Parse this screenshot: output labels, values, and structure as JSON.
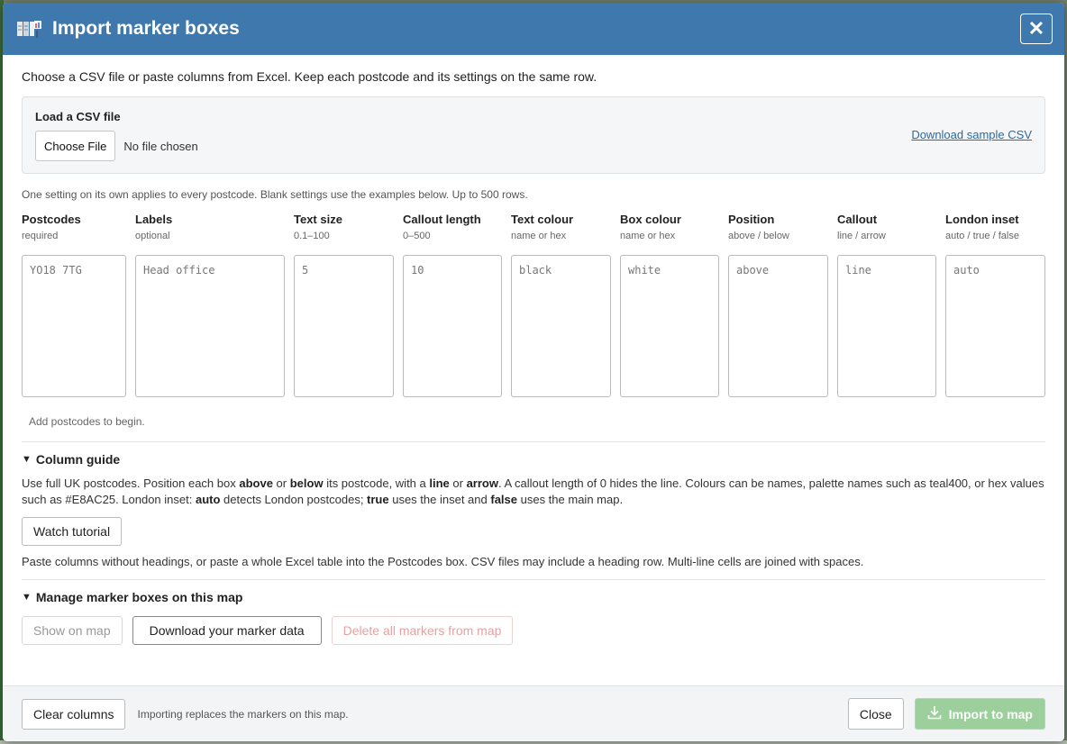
{
  "dialog": {
    "title": "Import marker boxes",
    "close_symbol": "✕",
    "intro": "Choose a CSV file or paste columns from Excel. Keep each postcode and its settings on the same row."
  },
  "csv": {
    "label": "Load a CSV file",
    "choose_button": "Choose File",
    "file_status": "No file chosen",
    "sample_link": "Download sample CSV"
  },
  "note": "One setting on its own applies to every postcode. Blank settings use the examples below. Up to 500 rows.",
  "columns": [
    {
      "header": "Postcodes",
      "sub": "required",
      "placeholder": "YO18 7TG"
    },
    {
      "header": "Labels",
      "sub": "optional",
      "placeholder": "Head office"
    },
    {
      "header": "Text size",
      "sub": "0.1–100",
      "placeholder": "5"
    },
    {
      "header": "Callout length",
      "sub": "0–500",
      "placeholder": "10"
    },
    {
      "header": "Text colour",
      "sub": "name or hex",
      "placeholder": "black"
    },
    {
      "header": "Box colour",
      "sub": "name or hex",
      "placeholder": "white"
    },
    {
      "header": "Position",
      "sub": "above / below",
      "placeholder": "above"
    },
    {
      "header": "Callout",
      "sub": "line / arrow",
      "placeholder": "line"
    },
    {
      "header": "London inset",
      "sub": "auto / true / false",
      "placeholder": "auto"
    }
  ],
  "status": "Add postcodes to begin.",
  "guide": {
    "title": "Column guide",
    "t1": "Use full UK postcodes. Position each box ",
    "b1": "above",
    "t2": " or ",
    "b2": "below",
    "t3": " its postcode, with a ",
    "b3": "line",
    "t4": " or ",
    "b4": "arrow",
    "t5": ". A callout length of 0 hides the line. Colours can be names, palette names such as teal400, or hex values such as #E8AC25. London inset: ",
    "b5": "auto",
    "t6": " detects London postcodes; ",
    "b6": "true",
    "t7": " uses the inset and ",
    "b7": "false",
    "t8": " uses the main map.",
    "tutorial_button": "Watch tutorial",
    "paste_note": "Paste columns without headings, or paste a whole Excel table into the Postcodes box. CSV files may include a heading row. Multi-line cells are joined with spaces."
  },
  "manage": {
    "title": "Manage marker boxes on this map",
    "show_button": "Show on map",
    "download_button": "Download your marker data",
    "delete_button": "Delete all markers from map"
  },
  "footer": {
    "clear_button": "Clear columns",
    "note": "Importing replaces the markers on this map.",
    "close_button": "Close",
    "import_button": "Import to map"
  },
  "colors": {
    "header": "#3e78ad",
    "import": "#9ccf9c",
    "link": "#2a6aa3",
    "danger": "#e3a2a2"
  }
}
